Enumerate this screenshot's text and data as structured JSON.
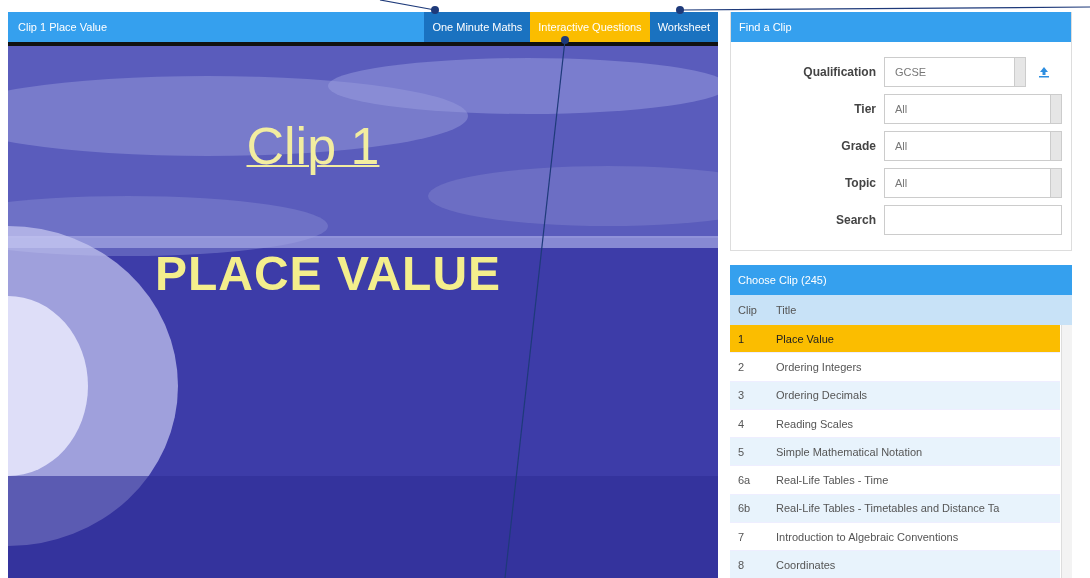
{
  "clip_panel": {
    "title": "Clip 1 Place Value",
    "tabs": [
      {
        "label": "One Minute Maths",
        "selected": false
      },
      {
        "label": "Interactive Questions",
        "selected": true
      },
      {
        "label": "Worksheet",
        "selected": false
      }
    ],
    "slide": {
      "heading": "Clip 1",
      "subtitle": "PLACE VALUE"
    }
  },
  "find_panel": {
    "title": "Find a Clip",
    "fields": [
      {
        "label": "Qualification",
        "kind": "select",
        "value": "GCSE"
      },
      {
        "label": "Tier",
        "kind": "select",
        "value": "All"
      },
      {
        "label": "Grade",
        "kind": "select",
        "value": "All"
      },
      {
        "label": "Topic",
        "kind": "select",
        "value": "All"
      },
      {
        "label": "Search",
        "kind": "text"
      }
    ]
  },
  "choose_panel": {
    "title": "Choose Clip (245)",
    "columns": [
      "Clip",
      "Title"
    ],
    "rows": [
      {
        "clip": "1",
        "title": "Place Value",
        "selected": true
      },
      {
        "clip": "2",
        "title": "Ordering Integers",
        "selected": false
      },
      {
        "clip": "3",
        "title": "Ordering Decimals",
        "selected": false
      },
      {
        "clip": "4",
        "title": "Reading Scales",
        "selected": false
      },
      {
        "clip": "5",
        "title": "Simple Mathematical Notation",
        "selected": false
      },
      {
        "clip": "6a",
        "title": "Real-Life Tables - Time",
        "selected": false
      },
      {
        "clip": "6b",
        "title": "Real-Life Tables - Timetables and Distance Ta",
        "selected": false
      },
      {
        "clip": "7",
        "title": "Introduction to Algebraic Conventions",
        "selected": false
      },
      {
        "clip": "8",
        "title": "Coordinates",
        "selected": false
      }
    ]
  }
}
